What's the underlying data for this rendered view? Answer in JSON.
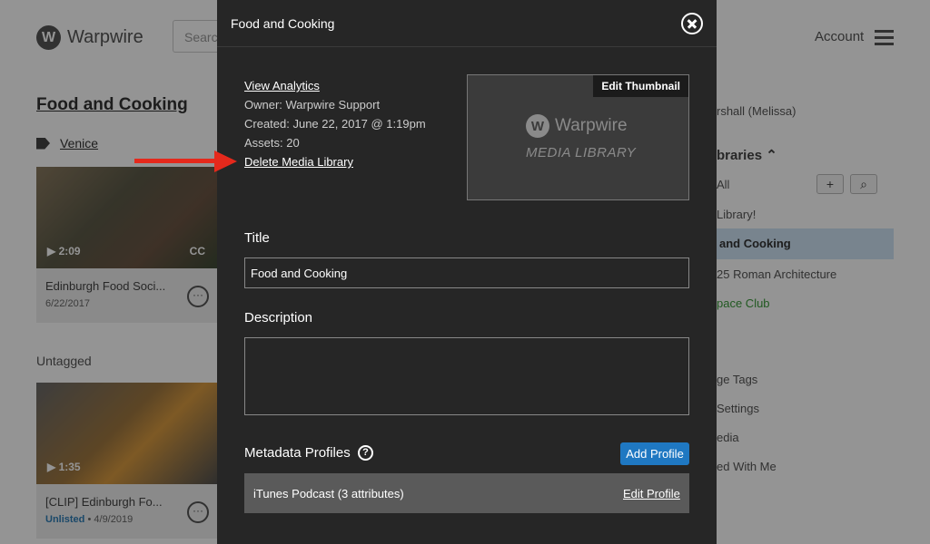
{
  "background": {
    "logo_text": "Warpwire",
    "logo_mark": "W",
    "search_placeholder": "Search",
    "account_label": "Account",
    "library_title": "Food and Cooking",
    "tag_label": "Venice",
    "cards": [
      {
        "duration": "▶ 2:09",
        "cc": "CC",
        "title": "Edinburgh Food Soci...",
        "date": "6/22/2017",
        "status": ""
      },
      {
        "duration": "▶ 1:35",
        "cc": "",
        "title": "[CLIP] Edinburgh Fo...",
        "date": "4/9/2019",
        "status": "Unlisted"
      }
    ],
    "untagged_label": "Untagged",
    "sidebar": {
      "user_partial": "rshall (Melissa)",
      "libraries_heading": "braries",
      "all_label": "All",
      "item_library": "Library!",
      "item_active": "and Cooking",
      "item_roman": "25 Roman Architecture",
      "item_space": "pace Club",
      "item_tags": "ge Tags",
      "item_settings": "Settings",
      "item_media": "edia",
      "item_shared": "ed With Me"
    }
  },
  "modal": {
    "title": "Food and Cooking",
    "view_analytics": "View Analytics",
    "owner": "Owner: Warpwire Support",
    "created": "Created: June 22, 2017 @ 1:19pm",
    "assets": "Assets: 20",
    "delete_library": "Delete Media Library",
    "edit_thumbnail": "Edit Thumbnail",
    "thumb_logo": "Warpwire",
    "thumb_logo_mark": "W",
    "thumb_subtitle": "MEDIA LIBRARY",
    "title_label": "Title",
    "title_value": "Food and Cooking",
    "description_label": "Description",
    "description_value": "",
    "metadata_label": "Metadata Profiles",
    "help_glyph": "?",
    "add_profile": "Add Profile",
    "profile_name": "iTunes Podcast (3 attributes)",
    "edit_profile": "Edit Profile"
  },
  "colors": {
    "modal_bg": "#262626",
    "accent_blue": "#1f78c2",
    "arrow_red": "#e5291c",
    "active_sidebar": "#cfe3f5"
  },
  "icons": [
    "close-icon",
    "help-icon",
    "tag-icon",
    "hamburger-icon",
    "more-icon",
    "plus-icon",
    "search-icon",
    "chevron-up-icon"
  ]
}
